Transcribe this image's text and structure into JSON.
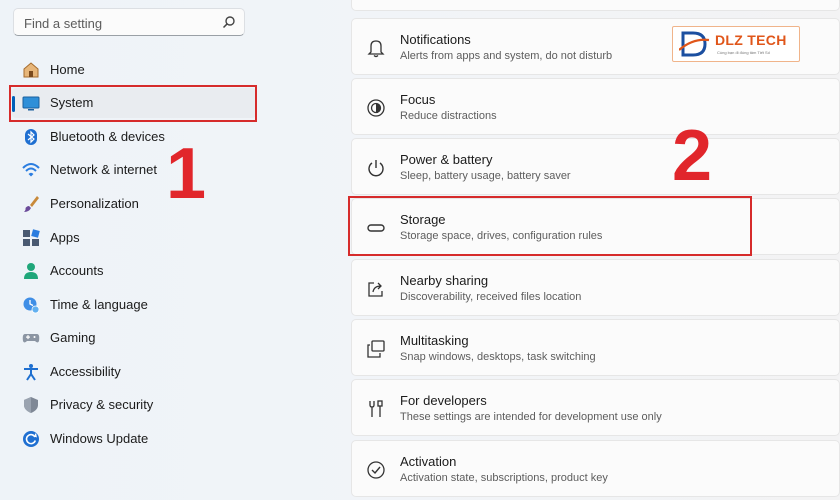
{
  "search": {
    "placeholder": "Find a setting"
  },
  "sidebar": {
    "items": [
      {
        "label": "Home",
        "icon": "home-icon"
      },
      {
        "label": "System",
        "icon": "monitor-icon"
      },
      {
        "label": "Bluetooth & devices",
        "icon": "bluetooth-icon"
      },
      {
        "label": "Network & internet",
        "icon": "wifi-icon"
      },
      {
        "label": "Personalization",
        "icon": "brush-icon"
      },
      {
        "label": "Apps",
        "icon": "apps-icon"
      },
      {
        "label": "Accounts",
        "icon": "person-icon"
      },
      {
        "label": "Time & language",
        "icon": "clock-globe-icon"
      },
      {
        "label": "Gaming",
        "icon": "gamepad-icon"
      },
      {
        "label": "Accessibility",
        "icon": "accessibility-icon"
      },
      {
        "label": "Privacy & security",
        "icon": "shield-icon"
      },
      {
        "label": "Windows Update",
        "icon": "update-icon"
      }
    ]
  },
  "settings": [
    {
      "title": "Notifications",
      "subtitle": "Alerts from apps and system, do not disturb",
      "icon": "bell-icon"
    },
    {
      "title": "Focus",
      "subtitle": "Reduce distractions",
      "icon": "focus-icon"
    },
    {
      "title": "Power & battery",
      "subtitle": "Sleep, battery usage, battery saver",
      "icon": "power-icon"
    },
    {
      "title": "Storage",
      "subtitle": "Storage space, drives, configuration rules",
      "icon": "storage-icon"
    },
    {
      "title": "Nearby sharing",
      "subtitle": "Discoverability, received files location",
      "icon": "share-icon"
    },
    {
      "title": "Multitasking",
      "subtitle": "Snap windows, desktops, task switching",
      "icon": "multitask-icon"
    },
    {
      "title": "For developers",
      "subtitle": "These settings are intended for development use only",
      "icon": "tools-icon"
    },
    {
      "title": "Activation",
      "subtitle": "Activation state, subscriptions, product key",
      "icon": "check-circle-icon"
    }
  ],
  "annotations": {
    "step1": "1",
    "step2": "2",
    "highlight_color": "#d62b2b"
  },
  "logo": {
    "text": "DLZ TECH",
    "tagline": "Cùng bạn đi đúng tâm Tiết Số"
  },
  "colors": {
    "accent": "#005fb8",
    "annotation": "#e1262b",
    "logo": "#e0561a"
  }
}
